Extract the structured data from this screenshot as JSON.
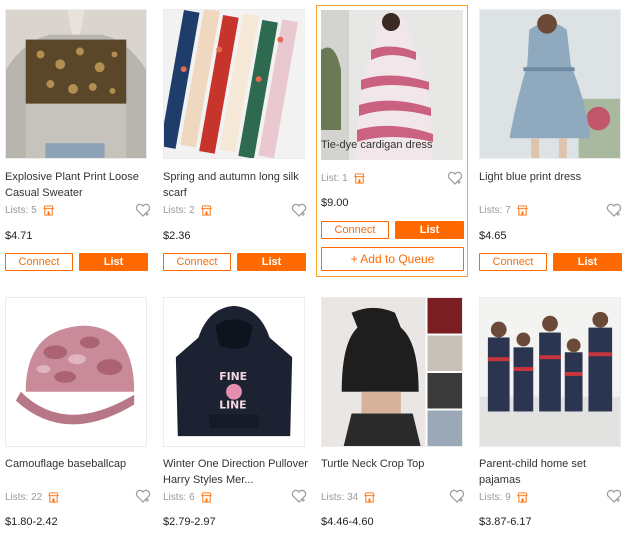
{
  "products": [
    {
      "title": "Explosive Plant Print Loose Casual Sweater",
      "lists_label": "Lists: 5",
      "price": "$4.71",
      "connect": "Connect",
      "list": "List"
    },
    {
      "title": "Spring and autumn long silk scarf",
      "lists_label": "Lists: 2",
      "price": "$2.36",
      "connect": "Connect",
      "list": "List"
    },
    {
      "title": "Tie-dye cardigan dress",
      "lists_label": "List: 1",
      "price": "$9.00",
      "connect": "Connect",
      "list": "List",
      "queue": "+ Add to Queue"
    },
    {
      "title": "Light blue print dress",
      "lists_label": "Lists: 7",
      "price": "$4.65",
      "connect": "Connect",
      "list": "List"
    },
    {
      "title": "Camouflage baseballcap",
      "lists_label": "Lists: 22",
      "price": "$1.80-2.42"
    },
    {
      "title": "Winter One Direction Pullover Harry Styles Mer...",
      "lists_label": "Lists: 6",
      "price": "$2.79-2.97"
    },
    {
      "title": "Turtle Neck Crop Top",
      "lists_label": "Lists: 34",
      "price": "$4.46-4.60"
    },
    {
      "title": "Parent-child home set pajamas",
      "lists_label": "Lists: 9",
      "price": "$3.87-6.17"
    }
  ],
  "hoodie_print": [
    "FINE",
    "LINE"
  ],
  "colors": {
    "accent": "#ff6a00",
    "hover_border": "#f5a623"
  }
}
